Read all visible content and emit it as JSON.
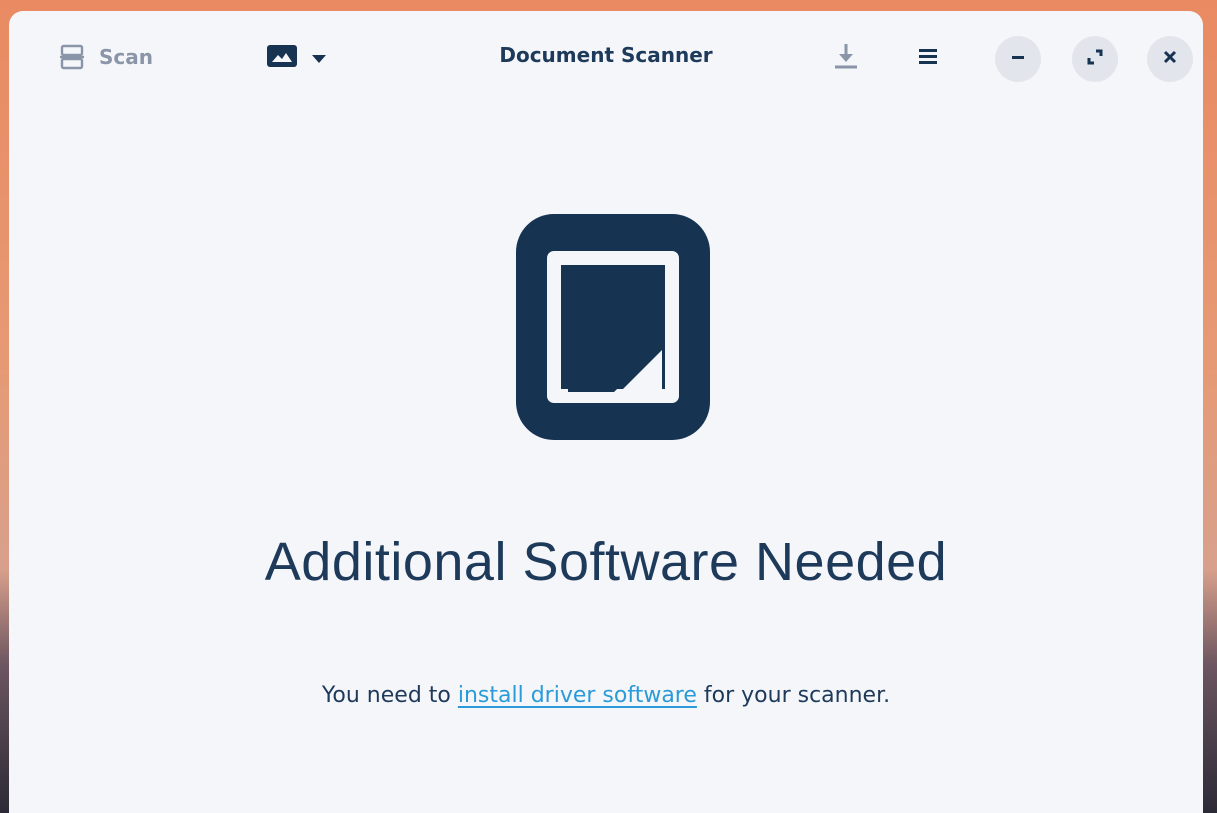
{
  "window": {
    "title": "Document Scanner"
  },
  "toolbar": {
    "scan_label": "Scan",
    "scan_icon": "scanner-icon",
    "document_type_icon": "image-icon",
    "dropdown_icon": "chevron-down-icon",
    "save_icon": "download-icon",
    "menu_icon": "hamburger-menu-icon"
  },
  "window_controls": {
    "minimize_icon": "minimize-icon",
    "maximize_icon": "maximize-icon",
    "close_icon": "close-icon"
  },
  "status": {
    "icon": "document-scanner-icon",
    "heading": "Additional Software Needed",
    "message_before": "You need to ",
    "link_text": "install driver software",
    "message_after": " for your scanner."
  },
  "colors": {
    "window_background": "#f5f6fa",
    "primary_text": "#1e3a5a",
    "disabled_text": "#8a96a8",
    "link": "#2a9bd8",
    "icon_dark": "#163352",
    "control_button_bg": "#e3e5ec"
  }
}
